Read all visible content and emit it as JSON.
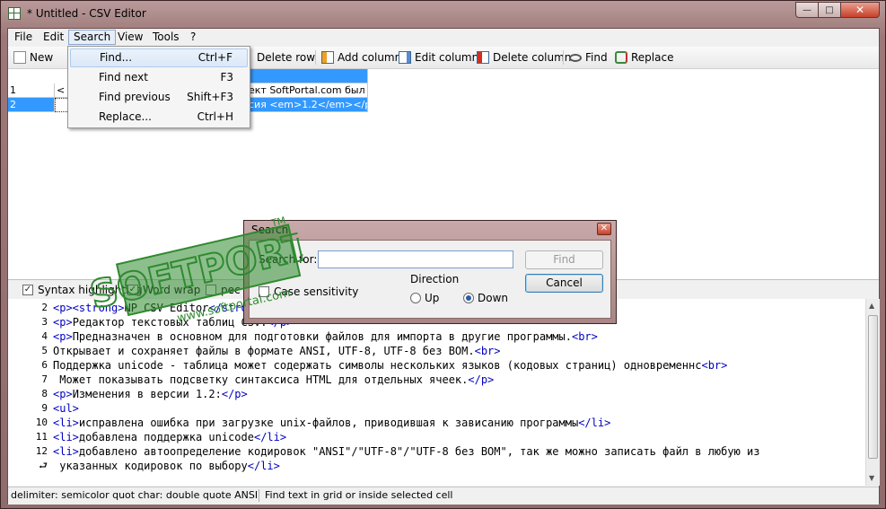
{
  "window": {
    "title": "* Untitled - CSV Editor",
    "min_label": "—",
    "max_label": "□",
    "close_label": "✕"
  },
  "menubar": [
    "File",
    "Edit",
    "Search",
    "View",
    "Tools",
    "?"
  ],
  "toolbar": {
    "new": "New",
    "delete_row": "Delete row",
    "add_column": "Add column",
    "edit_column": "Edit column",
    "delete_column": "Delete column",
    "find": "Find",
    "replace": "Replace"
  },
  "grid": {
    "rows": [
      {
        "num": "1",
        "col1": "<",
        "col2": "ект SoftPortal.com был за"
      },
      {
        "num": "2",
        "col1": "",
        "col2": "сия <em>1.2</em></p>"
      }
    ]
  },
  "search_menu": [
    {
      "label": "Find...",
      "shortcut": "Ctrl+F"
    },
    {
      "label": "Find next",
      "shortcut": "F3"
    },
    {
      "label": "Find previous",
      "shortcut": "Shift+F3"
    },
    {
      "label": "Replace...",
      "shortcut": "Ctrl+H"
    }
  ],
  "options": {
    "syntax_highlighting": "Syntax highlighting",
    "word_wrap": "Word wrap",
    "third_partial": "pec"
  },
  "editor_lines": [
    {
      "n": "2",
      "pre": "",
      "t1": "<p><strong>",
      "mid": "NP CSV Editor",
      "t2": "</strong></p>",
      "post": ""
    },
    {
      "n": "3",
      "pre": "",
      "t1": "<p>",
      "mid": "Редактор текстовых таблиц CSV.",
      "t2": "</p>",
      "post": ""
    },
    {
      "n": "4",
      "pre": "",
      "t1": "<p>",
      "mid": "Предназначен в основном для подготовки файлов для импорта в другие программы.",
      "t2": "<br>",
      "post": ""
    },
    {
      "n": "5",
      "pre": "",
      "t1": "",
      "mid": "Открывает и сохраняет файлы в формате ANSI, UTF-8, UTF-8 без BOM.",
      "t2": "<br>",
      "post": ""
    },
    {
      "n": "6",
      "pre": "",
      "t1": "",
      "mid": "Поддержка unicode - таблица может содержать символы нескольких языков (кодовых страниц) одновременнс",
      "t2": "<br>",
      "post": ""
    },
    {
      "n": "7",
      "pre": "",
      "t1": "",
      "mid": " Может показывать подсветку синтаксиса HTML для отдельных ячеек.",
      "t2": "</p>",
      "post": ""
    },
    {
      "n": "8",
      "pre": "",
      "t1": "<p>",
      "mid": "Изменения в версии 1.2:",
      "t2": "</p>",
      "post": ""
    },
    {
      "n": "9",
      "pre": "",
      "t1": "<ul>",
      "mid": "",
      "t2": "",
      "post": ""
    },
    {
      "n": "10",
      "pre": "",
      "t1": "<li>",
      "mid": "исправлена ошибка при загрузке unix-файлов, приводившая к зависанию программы",
      "t2": "</li>",
      "post": ""
    },
    {
      "n": "11",
      "pre": "",
      "t1": "<li>",
      "mid": "добавлена поддержка unicode",
      "t2": "</li>",
      "post": ""
    },
    {
      "n": "12",
      "pre": "",
      "t1": "<li>",
      "mid": "добавлено автоопределение кодировок \"ANSI\"/\"UTF-8\"/\"UTF-8 без BOM\", так же можно записать файл в любую из",
      "t2": "",
      "post": ""
    },
    {
      "n": "⮐",
      "pre": "",
      "t1": "",
      "mid": " указанных кодировок по выбору",
      "t2": "</li>",
      "post": ""
    }
  ],
  "status": {
    "left": "delimiter: semicolor  quot char: double quote  ANSI",
    "right": "Find text in grid or inside selected cell"
  },
  "dialog": {
    "title": "Search",
    "close_label": "✕",
    "search_label": "Search for:",
    "search_value": "",
    "case_sensitivity": "Case sensitivity",
    "direction_label": "Direction",
    "up": "Up",
    "down": "Down",
    "find_button": "Find",
    "cancel_button": "Cancel"
  },
  "watermark": {
    "brand": "SOFTPORTAL",
    "tm": "TM",
    "url": "www.softportal.com"
  },
  "colors": {
    "selection": "#3399ff",
    "tag": "#0000c0",
    "watermark": "#2f8a2f"
  }
}
